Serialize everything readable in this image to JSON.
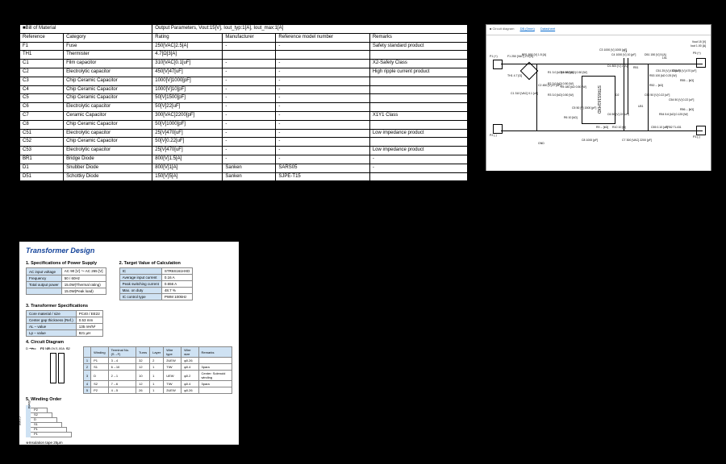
{
  "bom": {
    "title": "■Bill of Material",
    "output_params": "Output Parameters, Vout:15[V], Iout_typ:1[A], Iout_max:1[A]",
    "headers": [
      "Reference",
      "Category",
      "Rating",
      "Manufacturer",
      "Reference model number",
      "Remarks"
    ],
    "rows": [
      [
        "F1",
        "Fuse",
        "250[VAC]2.5[A]",
        "-",
        "-",
        "Safety standard product"
      ],
      [
        "TH1",
        "Thermister",
        "4.7[Ω]3[A]",
        "",
        "",
        ""
      ],
      [
        "C1",
        "Film capacitor",
        "310[VAC]0.1[uF]",
        "-",
        "-",
        "X2-Safety Class"
      ],
      [
        "C2",
        "Electrolytic capacitor",
        "450[V]47[uF]",
        "-",
        "-",
        "High ripple current product"
      ],
      [
        "C3",
        "Chip Ceramic Capacitor",
        "1000[V]1000[pF]",
        "-",
        "-",
        ""
      ],
      [
        "C4",
        "Chip Ceramic Capacitor",
        "1000[V]10[pF]",
        "-",
        "-",
        ""
      ],
      [
        "C5",
        "Chip Ceramic Capacitor",
        "50[V]1500[pF]",
        "-",
        "-",
        ""
      ],
      [
        "C6",
        "Electrolytic capacitor",
        "50[V]22[uF]",
        "-",
        "-",
        ""
      ],
      [
        "C7",
        "Ceramic Capacitor",
        "300[VAC]2200[pF]",
        "-",
        "-",
        "X1Y1 Class"
      ],
      [
        "C8",
        "Chip Ceramic Capacitor",
        "50[V]1000[pF]",
        "-",
        "-",
        ""
      ],
      [
        "C51",
        "Electrolytic capacitor",
        "25[V]470[uF]",
        "-",
        "-",
        "Low impedance product"
      ],
      [
        "C52",
        "Chip Ceramic Capacitor",
        "50[V]0.22[uF]",
        "-",
        "-",
        ""
      ],
      [
        "C53",
        "Electrolytic capacitor",
        "25[V]470[uF]",
        "-",
        "-",
        "Low impedance product"
      ],
      [
        "BR1",
        "Bridge Diode",
        "800[V]1.5[A]",
        "-",
        "-",
        "-"
      ],
      [
        "D1",
        "Snubber Diode",
        "800[V]1[A]",
        "Sanken",
        "SARS05",
        "-"
      ],
      [
        "D51",
        "Schottky Diode",
        "150[V]5[A]",
        "Sanken",
        "SJPE-T15",
        ""
      ]
    ]
  },
  "schematic": {
    "tab_label": "■ Circuit diagram",
    "dim_link": "DB (0mm)",
    "datasheet_link": "Datasheet",
    "chip_label": "STR6S161HXD",
    "nodes": {
      "p1": "P1 (+)",
      "p2": "P2 (-)",
      "ps": "P5 (+)",
      "pn": "P3 (-)",
      "gnd": "GND",
      "vout": "Vout 15 [V]",
      "iout": "Iout 1.00 [A]",
      "f1": "F1 250 [VAC] 2.5 [A]",
      "th1": "TH1 4.7 [Ω]",
      "br1": "BR1 800 [V] 1.5 [A]",
      "c1": "C1 310 [VAC] 0.1 [uF]",
      "c2": "C2 450 [V] 47 [uF]",
      "r1": "R1 3.0 [kΩ] 0.50 [W]",
      "r2": "R2 3.0 [kΩ] 0.50 [W]",
      "r3": "R3 3.0 [kΩ] 0.50 [W]",
      "r4": "R4 180 [kΩ] 0.50 [W]",
      "r5": "R5 180 [kΩ 0.50 [W]",
      "r6": "R6 10 [kΩ]",
      "r9": "R9 -- [kΩ]",
      "r10": "R10 10 [Ω]",
      "c3": "C3 1000 [V] 1000 [pF]",
      "c4": "C4 1000 [V] 10 [pF]",
      "c5": "C5 50 [V] 1500 [pF]",
      "c6": "C6 50 [V] 22 [uF]",
      "c7": "C7 300 [VAC] 2200 [pF]",
      "c8": "C8 1000 [pF]",
      "d1": "D1 800 [V] 1 [A]",
      "d2": "D2",
      "d51": "D51 150 [V] 5 [A]",
      "r51": "R51",
      "r52": "R52 -- [kΩ]",
      "r53": "R53 100 [kΩ 0.25 [W]",
      "r54": "R54 5.6 [kΩ] 0.125 [W]",
      "r55": "R55 -- [kΩ]",
      "r56": "R56 -- [kΩ]",
      "c51": "C51 25 [V] 470 [uF]",
      "c52": "C52 50 [V] 0.22 [uF]",
      "c53": "C53 25 [V] 470 [uF]",
      "c54": "C54 50 [V] 0.22 [uF]",
      "c55": "C55 0.10 [uF]",
      "l51": "L51",
      "u51": "U51",
      "u52": "SR52 TL431",
      "pins": "D/ST 8  S/OCP 1  VCC 5  BR 4  GND 2  FB 3",
      "xfmr": "T1"
    }
  },
  "xfmr": {
    "title": "Transformer Design",
    "sec1_h": "1. Specifications of Power Supply",
    "sec1": [
      [
        "AC input voltage",
        "AC 90 [V] ～ AC 265 [V]"
      ],
      [
        "Frequency",
        "50 / 60Hz"
      ],
      [
        "Total output power",
        "15.0W(Thermal rating)"
      ],
      [
        "",
        "15.0W(Peak load)"
      ]
    ],
    "sec2_h": "2. Target Value of Calculation",
    "sec2": [
      [
        "IC",
        "STR6S161HXD"
      ],
      [
        "Average input current",
        "0.16 A"
      ],
      [
        "Peak switching current",
        "0.656 A"
      ],
      [
        "Max. on duty",
        "48.7 %"
      ],
      [
        "IC control type",
        "PWM 100kHz"
      ]
    ],
    "sec3_h": "3. Transformer Specifications",
    "sec3": [
      [
        "Core material / size",
        "PC40 / EE22"
      ],
      [
        "Center gap thickness (Ref.)",
        "0.53 mm"
      ],
      [
        "AL – value",
        "135 nH/N²"
      ],
      [
        "Lp – value",
        "821 µH"
      ]
    ],
    "sec4_h": "4. Circuit Diagram",
    "sec4_labels": {
      "left1": "15.0V/1.00A",
      "p2": "P2",
      "p1": "P1",
      "d": "D ⟶",
      "vcc": "Vcc",
      "np": "NP",
      "s2": "S2",
      "ns": "NS",
      "s": "S"
    },
    "sec4_headers": [
      "",
      "Winding",
      "Terminal No.(S→F)",
      "Turns",
      "Layer",
      "Wire type",
      "Wire size",
      "Remarks"
    ],
    "sec4_rows": [
      [
        "1",
        "P1",
        "3→4",
        "32",
        "2",
        "2UEW",
        "φ0.26",
        ""
      ],
      [
        "2",
        "S1",
        "6→10",
        "12",
        "1",
        "TIW",
        "φ0.4",
        "3para"
      ],
      [
        "3",
        "D",
        "2→1",
        "10",
        "1",
        "UEW",
        "φ0.2",
        "Center: Solenoid winding"
      ],
      [
        "4",
        "S2",
        "7→6",
        "12",
        "1",
        "TIW",
        "φ0.4",
        "3para"
      ],
      [
        "5",
        "P2",
        "4→5",
        "26",
        "1",
        "2UEW",
        "φ0.26",
        ""
      ]
    ],
    "sec5_h": "5. Winding Order",
    "sec5_core": "CORE",
    "sec5_layers": [
      "P1",
      "P1",
      "S1",
      "D",
      "S2",
      "P2"
    ],
    "sec5_pin": "Pin",
    "sec5_note": "※Insulation tape 25µm",
    "sec5_side": "Sheld"
  }
}
